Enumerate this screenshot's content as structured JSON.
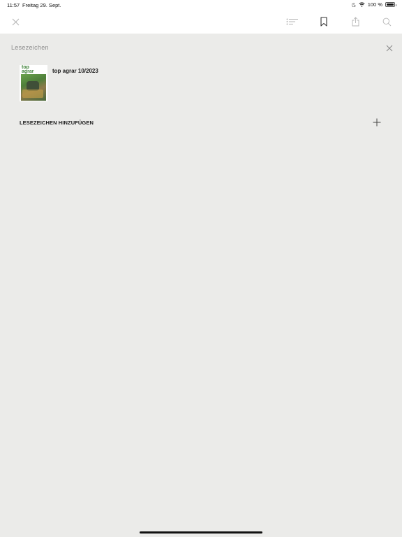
{
  "status_bar": {
    "time": "11:57",
    "date": "Freitag 29. Sept.",
    "battery": "100 %"
  },
  "toolbar": {
    "icons": [
      "close-icon",
      "table-of-contents-icon",
      "bookmark-icon",
      "share-icon",
      "search-icon"
    ]
  },
  "panel": {
    "title": "Lesezeichen",
    "bookmarks": [
      {
        "title": "top agrar 10/2023",
        "thumb_heading": [
          "top",
          "agrar"
        ]
      }
    ],
    "add_label": "LESEZEICHEN HINZUFÜGEN"
  },
  "colors": {
    "panel_bg": "#ebebe9",
    "toolbar_bg": "#ffffff",
    "icon_gray": "#b5b5b5"
  }
}
